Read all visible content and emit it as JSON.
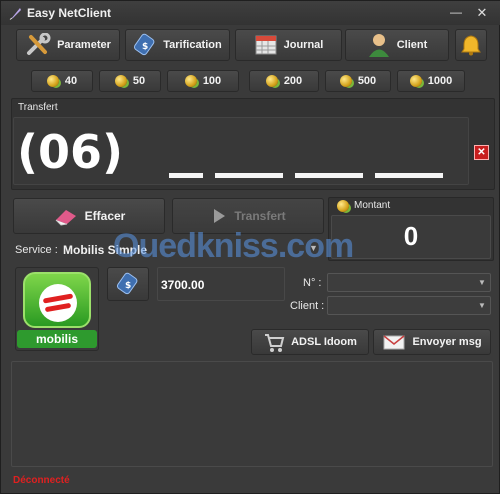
{
  "app": {
    "title": "Easy NetClient"
  },
  "toolbar": {
    "parameter": "Parameter",
    "tarification": "Tarification",
    "journal": "Journal",
    "client": "Client"
  },
  "amounts": [
    "40",
    "50",
    "100",
    "200",
    "500",
    "1000"
  ],
  "transfer": {
    "section_label": "Transfert",
    "prefix": "(06)"
  },
  "actions": {
    "effacer": "Effacer",
    "transfert": "Transfert"
  },
  "montant": {
    "label": "Montant",
    "value": "0"
  },
  "service": {
    "label": "Service :",
    "selected": "Mobilis Simple"
  },
  "operator": {
    "logo_text": "mobilis"
  },
  "balance": {
    "value": "3700.00"
  },
  "form": {
    "number_label": "N° :",
    "client_label": "Client :"
  },
  "buttons": {
    "adsl": "ADSL Idoom",
    "envoyer": "Envoyer msg"
  },
  "watermark": {
    "text": "Ouedkniss.com"
  },
  "status": {
    "text": "Déconnecté"
  },
  "colors": {
    "accent": "#2e9a2e",
    "error": "#c81e1e",
    "status": "#e02020"
  }
}
